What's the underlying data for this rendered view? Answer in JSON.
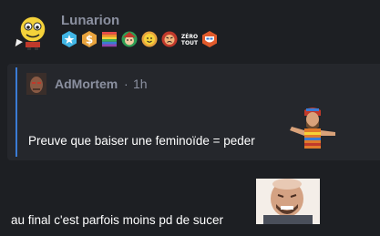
{
  "post": {
    "username": "Lunarion",
    "avatar_icon": "smiley-pirate-avatar",
    "badges": [
      {
        "icon": "star-hexagon-badge-icon",
        "color": "#41b6e6"
      },
      {
        "icon": "dollar-hexagon-badge-icon",
        "color": "#e8a33d"
      },
      {
        "icon": "rainbow-badge-icon",
        "color": "#e64b4b"
      },
      {
        "icon": "elf-face-badge-icon",
        "color": "#2f9e55"
      },
      {
        "icon": "smiley-face-badge-icon",
        "color": "#f5c542"
      },
      {
        "icon": "angry-face-badge-icon",
        "color": "#c0392b"
      },
      {
        "icon": "zero-tout-badge-icon",
        "text_top": "ZÉRO",
        "text_bottom": "TOUT"
      },
      {
        "icon": "shield-badge-icon",
        "color": "#e05a2b"
      }
    ]
  },
  "quote": {
    "author": "AdMortem",
    "separator": "·",
    "time": "1h",
    "text": "Preuve que baiser une feminoïde = peder",
    "accent_color": "#3a7bd5"
  },
  "message": {
    "text": "au final c'est parfois moins pd de sucer"
  }
}
